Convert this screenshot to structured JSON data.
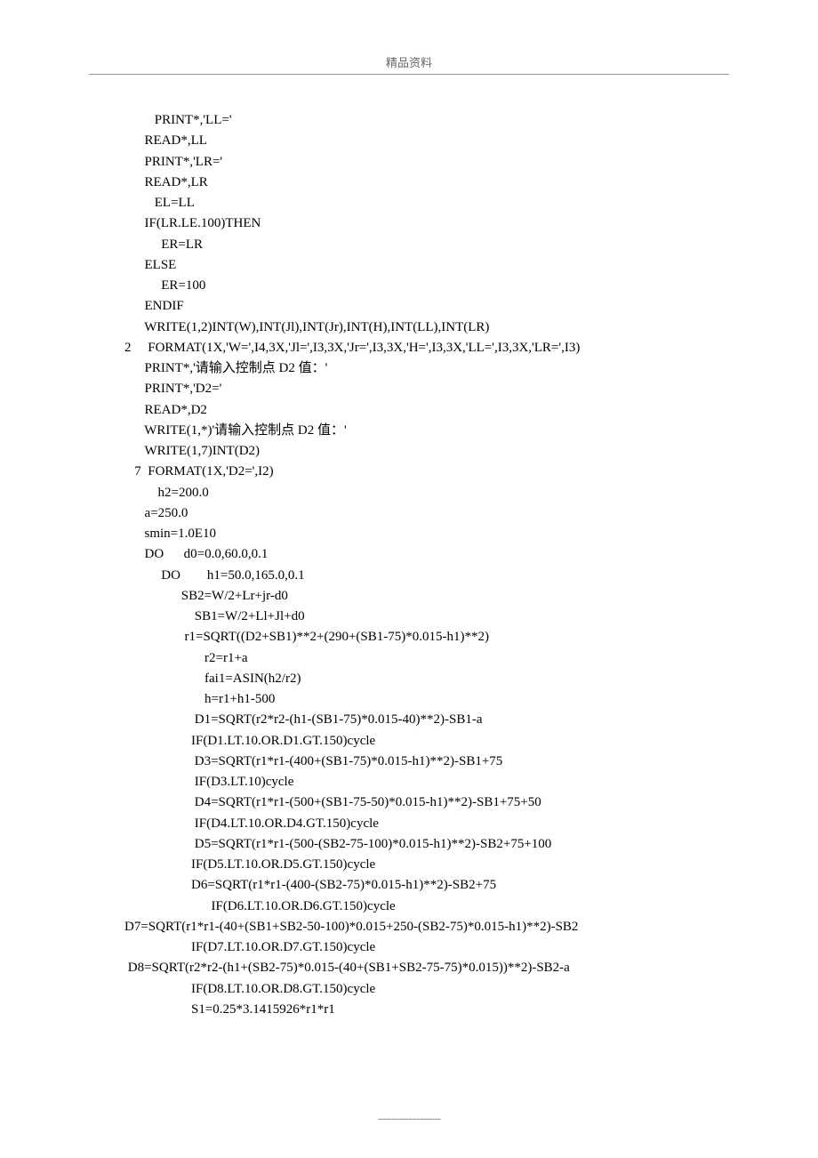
{
  "header": {
    "title": "精品资料"
  },
  "code_lines": [
    "         PRINT*,'LL='",
    "      READ*,LL",
    "      PRINT*,'LR='",
    "      READ*,LR",
    "         EL=LL",
    "      IF(LR.LE.100)THEN",
    "           ER=LR",
    "      ELSE",
    "           ER=100",
    "      ENDIF",
    "      WRITE(1,2)INT(W),INT(Jl),INT(Jr),INT(H),INT(LL),INT(LR)",
    "2     FORMAT(1X,'W=',I4,3X,'Jl=',I3,3X,'Jr=',I3,3X,'H=',I3,3X,'LL=',I3,3X,'LR=',I3)",
    "      PRINT*,'请输入控制点 D2 值：'",
    "      PRINT*,'D2='",
    "      READ*,D2",
    "      WRITE(1,*)'请输入控制点 D2 值：'",
    "      WRITE(1,7)INT(D2)",
    "   7  FORMAT(1X,'D2=',I2)",
    "          h2=200.0",
    "      a=250.0",
    "      smin=1.0E10",
    "      DO      d0=0.0,60.0,0.1",
    "           DO        h1=50.0,165.0,0.1",
    "                 SB2=W/2+Lr+jr-d0",
    "                     SB1=W/2+Ll+Jl+d0",
    "                  r1=SQRT((D2+SB1)**2+(290+(SB1-75)*0.015-h1)**2)",
    "                        r2=r1+a",
    "                        fai1=ASIN(h2/r2)",
    "                        h=r1+h1-500",
    "                     D1=SQRT(r2*r2-(h1-(SB1-75)*0.015-40)**2)-SB1-a",
    "                    IF(D1.LT.10.OR.D1.GT.150)cycle",
    "                     D3=SQRT(r1*r1-(400+(SB1-75)*0.015-h1)**2)-SB1+75",
    "                     IF(D3.LT.10)cycle",
    "                     D4=SQRT(r1*r1-(500+(SB1-75-50)*0.015-h1)**2)-SB1+75+50",
    "                     IF(D4.LT.10.OR.D4.GT.150)cycle",
    "                     D5=SQRT(r1*r1-(500-(SB2-75-100)*0.015-h1)**2)-SB2+75+100",
    "                    IF(D5.LT.10.OR.D5.GT.150)cycle",
    "                    D6=SQRT(r1*r1-(400-(SB2-75)*0.015-h1)**2)-SB2+75",
    "                          IF(D6.LT.10.OR.D6.GT.150)cycle",
    "D7=SQRT(r1*r1-(40+(SB1+SB2-50-100)*0.015+250-(SB2-75)*0.015-h1)**2)-SB2",
    "                    IF(D7.LT.10.OR.D7.GT.150)cycle",
    " D8=SQRT(r2*r2-(h1+(SB2-75)*0.015-(40+(SB1+SB2-75-75)*0.015))**2)-SB2-a",
    "                    IF(D8.LT.10.OR.D8.GT.150)cycle",
    "                    S1=0.25*3.1415926*r1*r1"
  ],
  "footer": {
    "marks": "..............................................."
  }
}
